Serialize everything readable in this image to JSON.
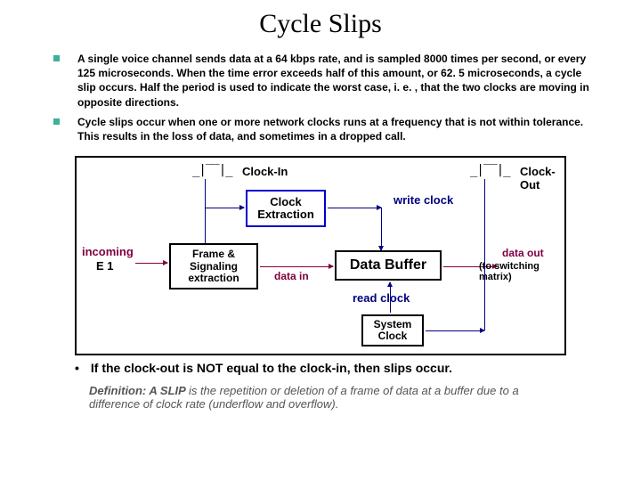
{
  "title": "Cycle Slips",
  "bullets": [
    "A single voice channel sends data at a 64 kbps rate, and is sampled 8000 times per second, or every 125 microseconds.  When the time error exceeds half of this amount, or 62. 5 microseconds, a cycle slip occurs.  Half the period is used to indicate the worst case, i. e. , that the two clocks are moving in opposite directions.",
    "Cycle slips occur when one or more network clocks runs at a frequency that is not within tolerance.  This results in the loss of data, and sometimes in a dropped call."
  ],
  "diagram": {
    "clock_in": "Clock-In",
    "clock_out": "Clock-Out",
    "clock_extraction": "Clock Extraction",
    "write_clock": "write clock",
    "incoming": "incoming",
    "e1": "E 1",
    "frame_signaling": "Frame & Signaling extraction",
    "data_in": "data in",
    "data_buffer": "Data Buffer",
    "data_out": "data out",
    "to_switching": "(to switching matrix)",
    "read_clock": "read clock",
    "system_clock": "System Clock"
  },
  "caption_bullet": "•",
  "caption": "If the clock-out is NOT equal to the clock-in, then slips occur.",
  "definition_label": "Definition: A SLIP ",
  "definition_rest": "is the repetition or deletion of a frame of data at a buffer due to a difference of clock rate (underflow and overflow)."
}
